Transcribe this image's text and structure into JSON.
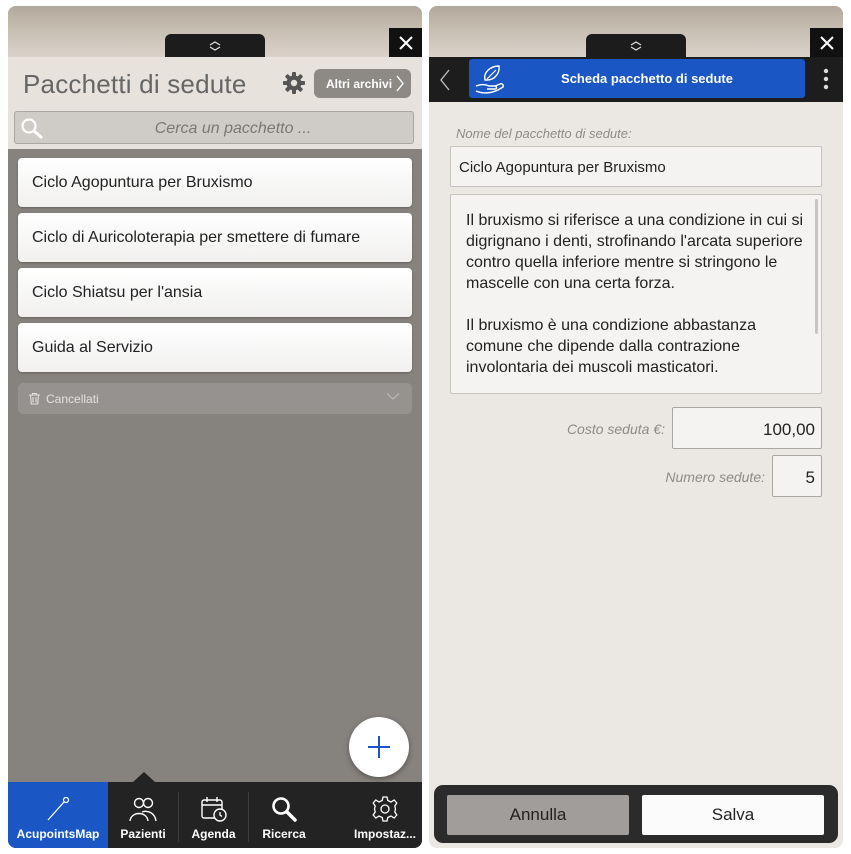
{
  "left": {
    "title": "Pacchetti di sedute",
    "archive_button": "Altri archivi",
    "search_placeholder": "Cerca un pacchetto ...",
    "packages": [
      "Ciclo Agopuntura per Bruxismo",
      "Ciclo di Auricoloterapia per smettere di fumare",
      "Ciclo Shiatsu per l'ansia",
      "Guida al Servizio"
    ],
    "deleted_label": "Cancellati",
    "tabs": [
      {
        "label": "AcupointsMap",
        "icon": "needle-icon",
        "active": true
      },
      {
        "label": "Pazienti",
        "icon": "people-icon",
        "active": false
      },
      {
        "label": "Agenda",
        "icon": "calendar-clock-icon",
        "active": false
      },
      {
        "label": "Ricerca",
        "icon": "search-icon",
        "active": false
      },
      {
        "label": "Impostaz...",
        "icon": "gear-icon",
        "active": false
      }
    ]
  },
  "right": {
    "title": "Scheda pacchetto di sedute",
    "name_label": "Nome del pacchetto di sedute:",
    "name_value": "Ciclo Agopuntura per Bruxismo",
    "description": [
      "Il bruxismo si riferisce a una condizione in cui si digrignano i denti, strofinando l'arcata superiore contro quella inferiore mentre si stringono le mascelle con una certa forza.",
      "Il bruxismo è una condizione abbastanza comune che dipende dalla contrazione involontaria dei muscoli masticatori."
    ],
    "cost_label": "Costo seduta €:",
    "cost_value": "100,00",
    "sessions_label": "Numero sedute:",
    "sessions_value": "5",
    "cancel_label": "Annulla",
    "save_label": "Salva"
  },
  "colors": {
    "accent_blue": "#1a56c4",
    "tabbar": "#232323",
    "left_background": "#86827e",
    "right_background": "#ebe8e4"
  }
}
